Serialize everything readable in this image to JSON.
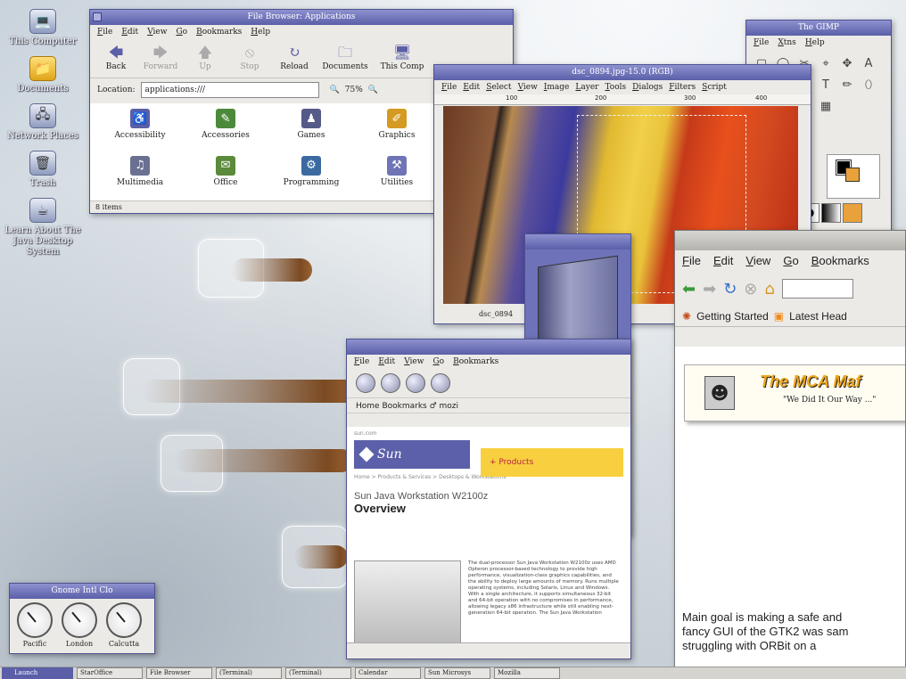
{
  "desktop": {
    "icons": [
      {
        "label": "This Computer",
        "icon": "computer-icon",
        "glyph": "💻"
      },
      {
        "label": "Documents",
        "icon": "folder-icon",
        "glyph": "📁"
      },
      {
        "label": "Network Places",
        "icon": "network-icon",
        "glyph": "🖧"
      },
      {
        "label": "Trash",
        "icon": "trash-icon",
        "glyph": "🗑"
      },
      {
        "label": "Learn About The Java Desktop System",
        "icon": "java-icon",
        "glyph": "☕"
      }
    ]
  },
  "file_browser": {
    "title": "File Browser: Applications",
    "menu": [
      "File",
      "Edit",
      "View",
      "Go",
      "Bookmarks",
      "Help"
    ],
    "toolbar": [
      {
        "label": "Back",
        "glyph": "🡄",
        "enabled": true
      },
      {
        "label": "Forward",
        "glyph": "🡆",
        "enabled": false
      },
      {
        "label": "Up",
        "glyph": "🡅",
        "enabled": false
      },
      {
        "label": "Stop",
        "glyph": "⦸",
        "enabled": false
      },
      {
        "label": "Reload",
        "glyph": "↻",
        "enabled": true
      },
      {
        "label": "Documents",
        "glyph": "🗀",
        "enabled": true
      },
      {
        "label": "This Comp",
        "glyph": "🖥",
        "enabled": true
      }
    ],
    "location_label": "Location:",
    "location_value": "applications:///",
    "zoom": "75%",
    "items": [
      {
        "label": "Accessibility",
        "color": "#5a5fa8",
        "glyph": "♿"
      },
      {
        "label": "Accessories",
        "color": "#4c8a3b",
        "glyph": "✎"
      },
      {
        "label": "Games",
        "color": "#555a88",
        "glyph": "♟"
      },
      {
        "label": "Graphics",
        "color": "#d49a22",
        "glyph": "✐"
      },
      {
        "label": "Multimedia",
        "color": "#6a7090",
        "glyph": "♫"
      },
      {
        "label": "Office",
        "color": "#5b8a3a",
        "glyph": "✉"
      },
      {
        "label": "Programming",
        "color": "#3b6aa0",
        "glyph": "⚙"
      },
      {
        "label": "Utilities",
        "color": "#6e74b6",
        "glyph": "⚒"
      }
    ],
    "status": "8 items"
  },
  "gimp_toolbox": {
    "title": "The GIMP",
    "menu": [
      "File",
      "Xtns",
      "Help"
    ],
    "tools": [
      "▢",
      "◯",
      "✂",
      "⌖",
      "✥",
      "A",
      "✛",
      "⤢",
      "🖌",
      "T",
      "✏",
      "⬯",
      "✗",
      "💧",
      "●",
      "▦"
    ]
  },
  "gimp_image": {
    "title": "dsc_0894.jpg-15.0 (RGB)",
    "menu": [
      "File",
      "Edit",
      "Select",
      "View",
      "Image",
      "Layer",
      "Tools",
      "Dialogs",
      "Filters",
      "Script"
    ],
    "ruler_marks": [
      "100",
      "200",
      "300",
      "400"
    ],
    "status": "dsc_0894"
  },
  "sun_browser": {
    "menu": [
      "File",
      "Edit",
      "View",
      "Go",
      "Bookmarks"
    ],
    "bookmarks": "Home  Bookmarks  ♂ mozi",
    "site_small": "sun.com",
    "logo": "Sun",
    "products_btn": "+ Products",
    "breadcrumb": "Home > Products & Services > Desktops & Workstations",
    "heading": "Sun Java Workstation W2100z",
    "subheading": "Overview",
    "body": "The dual-processor Sun Java Workstation W2100z uses AMD Opteron processor-based technology to provide high performance, visualization-class graphics capabilities, and the ability to deploy large amounts of memory. Runs multiple operating systems, including Solaris, Linux and Windows. With a single architecture, it supports simultaneous 32-bit and 64-bit operation with no compromises in performance, allowing legacy x86 infrastructure while still enabling next-generation 64-bit operation. The Sun Java Workstation"
  },
  "firefox": {
    "menu": [
      "File",
      "Edit",
      "View",
      "Go",
      "Bookmarks"
    ],
    "bookmarks": [
      "Getting Started",
      "Latest Head"
    ],
    "banner_title": "The MCA Maf",
    "banner_sub": "\"We Did It Our Way ...\"",
    "body_lines": [
      "Main goal is making a safe and",
      "fancy GUI of the GTK2 was sam",
      "struggling with ORBit on a"
    ]
  },
  "clock_applet": {
    "title": "Gnome Intl Clo",
    "clocks": [
      "Pacific",
      "London",
      "Calcutta"
    ]
  },
  "taskbar": {
    "start": "Launch",
    "tasks": [
      "StarOffice",
      "File Browser",
      "(Terminal)",
      "(Terminal)",
      "Calendar",
      "Sun Microsys",
      "Mozilla"
    ]
  }
}
